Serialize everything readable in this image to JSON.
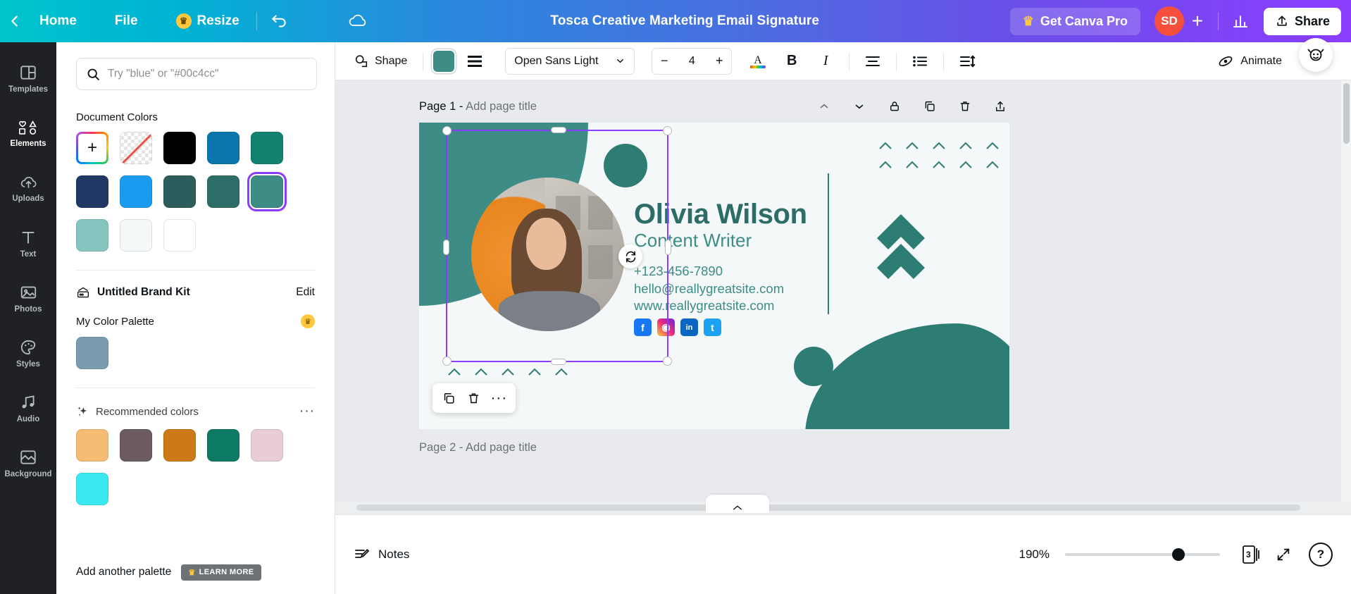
{
  "topbar": {
    "back_icon": "chevron-left-icon",
    "home": "Home",
    "file": "File",
    "resize": "Resize",
    "resize_badge": "crown-icon",
    "undo_icon": "undo-icon",
    "cloud_icon": "cloud-saved-icon",
    "doc_title": "Tosca Creative Marketing Email Signature",
    "pro_label": "Get Canva Pro",
    "pro_icon": "crown-icon",
    "avatar_initials": "SD",
    "plus_label": "+",
    "stats_icon": "bar-chart-icon",
    "share_label": "Share",
    "share_icon": "upload-icon"
  },
  "rail": {
    "items": [
      {
        "label": "Templates",
        "icon": "templates-icon",
        "active": false
      },
      {
        "label": "Elements",
        "icon": "elements-icon",
        "active": true
      },
      {
        "label": "Uploads",
        "icon": "uploads-icon",
        "active": false
      },
      {
        "label": "Text",
        "icon": "text-icon",
        "active": false
      },
      {
        "label": "Photos",
        "icon": "photos-icon",
        "active": false
      },
      {
        "label": "Styles",
        "icon": "styles-icon",
        "active": false
      },
      {
        "label": "Audio",
        "icon": "audio-icon",
        "active": false
      },
      {
        "label": "Background",
        "icon": "background-icon",
        "active": false
      }
    ]
  },
  "panel": {
    "search_placeholder": "Try \"blue\" or \"#00c4cc\"",
    "search_value": "",
    "document_colors_title": "Document Colors",
    "document_colors": [
      {
        "name": "add-color",
        "hex": ""
      },
      {
        "name": "no-color",
        "hex": ""
      },
      {
        "name": "black",
        "hex": "#000000"
      },
      {
        "name": "blue",
        "hex": "#0a76ad"
      },
      {
        "name": "green-teal",
        "hex": "#128270"
      },
      {
        "name": "navy",
        "hex": "#1f3864"
      },
      {
        "name": "bright-blue",
        "hex": "#1a9bf0"
      },
      {
        "name": "dark-teal",
        "hex": "#2d5c5c"
      },
      {
        "name": "teal-dark",
        "hex": "#2d6d68"
      },
      {
        "name": "teal-selected",
        "hex": "#3d8c85"
      },
      {
        "name": "light-teal",
        "hex": "#86c4bf"
      },
      {
        "name": "off-white",
        "hex": "#f4f8f8"
      },
      {
        "name": "white",
        "hex": "#ffffff"
      }
    ],
    "selected_color_index": 9,
    "brand_kit_label": "Untitled Brand Kit",
    "brand_kit_icon": "brand-kit-icon",
    "edit_label": "Edit",
    "my_palette_title": "My Color Palette",
    "my_palette_badge": "crown-icon",
    "my_palette_colors": [
      {
        "name": "steel-blue",
        "hex": "#7a9cb0"
      }
    ],
    "recommended_title": "Recommended colors",
    "recommended_icon": "sparkle-icon",
    "recommended_more": "···",
    "recommended_colors": [
      {
        "name": "sand",
        "hex": "#f5bd73"
      },
      {
        "name": "mauve",
        "hex": "#6e5a61"
      },
      {
        "name": "ochre",
        "hex": "#cc7a17"
      },
      {
        "name": "pine",
        "hex": "#0d7a64"
      },
      {
        "name": "blush",
        "hex": "#e8cdd4"
      },
      {
        "name": "cyan",
        "hex": "#3ae8f0"
      }
    ],
    "add_palette_label": "Add another palette",
    "learn_more_label": "LEARN MORE",
    "learn_more_icon": "crown-icon"
  },
  "toolbar": {
    "shape_label": "Shape",
    "shape_icon": "shape-icon",
    "fill_color": "#3d8c85",
    "lines_icon": "lines-icon",
    "font_family": "Open Sans Light",
    "font_dropdown_icon": "chevron-down-icon",
    "font_size_minus": "−",
    "font_size": "4",
    "font_size_plus": "+",
    "text_color_icon": "text-color-icon",
    "bold_label": "B",
    "italic_label": "I",
    "align_icon": "align-center-icon",
    "list_icon": "bullet-list-icon",
    "spacing_icon": "line-spacing-icon",
    "animate_label": "Animate",
    "animate_icon": "animate-icon",
    "more_label": "···"
  },
  "canvas": {
    "page_number_label": "Page 1 -",
    "page_title_placeholder": "Add page title",
    "page_tools": [
      {
        "name": "collapse-page-icon"
      },
      {
        "name": "expand-page-icon"
      },
      {
        "name": "lock-page-icon"
      },
      {
        "name": "duplicate-page-icon"
      },
      {
        "name": "delete-page-icon"
      },
      {
        "name": "export-page-icon"
      }
    ],
    "rotate_icon": "rotate-icon",
    "context_bar": [
      {
        "name": "duplicate-icon"
      },
      {
        "name": "trash-icon"
      },
      {
        "name": "more-icon"
      }
    ],
    "next_page_label": "Page 2 - Add page title"
  },
  "design": {
    "name": "Olivia Wilson",
    "role": "Content Writer",
    "phone": "+123-456-7890",
    "email": "hello@reallygreatsite.com",
    "website": "www.reallygreatsite.com",
    "social": [
      {
        "name": "facebook-icon",
        "glyph": "f",
        "color": "#1877f2"
      },
      {
        "name": "instagram-icon",
        "glyph": "◉",
        "color": "#c13584"
      },
      {
        "name": "linkedin-icon",
        "glyph": "in",
        "color": "#0a66c2"
      },
      {
        "name": "twitter-icon",
        "glyph": "t",
        "color": "#1da1f2"
      }
    ],
    "colors": {
      "teal": "#3d8c85",
      "teal_dark": "#2d7d75",
      "teal_text": "#2d6d68",
      "page_bg": "#f4f8f8",
      "orange": "#e8861f"
    }
  },
  "bottombar": {
    "notes_label": "Notes",
    "notes_icon": "notes-icon",
    "zoom_level": "190%",
    "page_count": "3",
    "pages_icon": "pages-icon",
    "fullscreen_icon": "fullscreen-icon",
    "help_label": "?"
  },
  "assistant": {
    "icon": "assistant-icon"
  }
}
